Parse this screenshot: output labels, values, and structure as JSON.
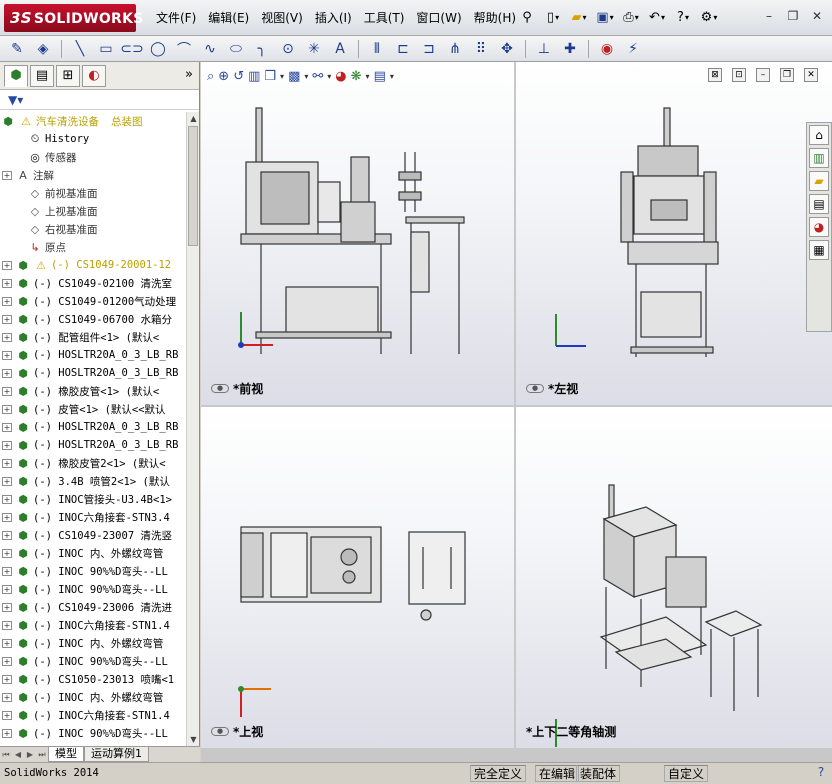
{
  "app": {
    "logo_prefix": "3S",
    "logo_text": "SOLIDWORKS"
  },
  "menu": [
    "文件(F)",
    "编辑(E)",
    "视图(V)",
    "插入(I)",
    "工具(T)",
    "窗口(W)",
    "帮助(H)"
  ],
  "title_icons": [
    "pin-icon",
    "new-document-icon",
    "open-folder-icon",
    "save-icon",
    "print-icon",
    "undo-icon",
    "help-icon",
    "options-icon"
  ],
  "window_controls": [
    "minimize-icon",
    "restore-icon",
    "close-icon"
  ],
  "command_icons": [
    "sketch-icon",
    "smart-dimension-icon",
    "line-icon",
    "rectangle-icon",
    "slot-icon",
    "circle-icon",
    "arc-icon",
    "spline-icon",
    "ellipse-icon",
    "fillet-icon",
    "point-icon",
    "centerline-icon",
    "text-icon",
    "mirror-icon",
    "offset-icon",
    "convert-icon",
    "trim-icon",
    "pattern-icon",
    "move-icon",
    "relation-icon",
    "repair-icon",
    "rapid-sketch-icon",
    "instant2d-icon"
  ],
  "panel_tabs": [
    "feature-manager-icon",
    "property-manager-icon",
    "configuration-manager-icon",
    "display-manager-icon"
  ],
  "panel_more": "»",
  "tree": {
    "root_name": "汽车清洗设备",
    "root_suffix": "总装图",
    "history": "History",
    "sensors": "传感器",
    "annotations": "注解",
    "plane_front": "前视基准面",
    "plane_top": "上视基准面",
    "plane_right": "右视基准面",
    "origin": "原点",
    "first_component": "(-) CS1049-20001-12",
    "components": [
      "(-) CS1049-02100 清洗室",
      "(-) CS1049-01200气动处理",
      "(-) CS1049-06700 水箱分",
      "(-) 配管组件<1> (默认<",
      "(-) HOSLTR20A_0_3_LB_RB",
      "(-) HOSLTR20A_0_3_LB_RB",
      "(-) 橡胶皮管<1> (默认<",
      "(-) 皮管<1> (默认<<默认",
      "(-) HOSLTR20A_0_3_LB_RB",
      "(-) HOSLTR20A_0_3_LB_RB",
      "(-) 橡胶皮管2<1> (默认<",
      "(-) 3.4B 喷管2<1> (默认",
      "(-) INOC管接头-U3.4B<1>",
      "(-) INOC六角接套-STN3.4",
      "(-) CS1049-23007 清洗竖",
      "(-) INOC 内、外螺纹弯管",
      "(-) INOC 90%%D弯头--LL",
      "(-) INOC 90%%D弯头--LL",
      "(-) CS1049-23006 清洗进",
      "(-) INOC六角接套-STN1.4",
      "(-) INOC 内、外螺纹弯管",
      "(-) INOC 90%%D弯头--LL",
      "(-) CS1050-23013 喷嘴<1",
      "(-) INOC 内、外螺纹弯管",
      "(-) INOC六角接套-STN1.4",
      "(-) INOC 90%%D弯头--LL"
    ]
  },
  "bottom_tabs": [
    "模型",
    "运动算例1"
  ],
  "view_toolbar_icons": [
    "zoom-to-fit-icon",
    "zoom-area-icon",
    "previous-view-icon",
    "section-view-icon",
    "view-orientation-icon",
    "display-style-icon",
    "hide-show-icon",
    "edit-appearance-icon",
    "apply-scene-icon",
    "view-settings-icon"
  ],
  "views": {
    "front": "*前视",
    "left": "*左视",
    "top": "*上视",
    "iso": "*上下二等角轴测"
  },
  "task_pane_icons": [
    "home-icon",
    "design-library-icon",
    "file-explorer-icon",
    "view-palette-icon",
    "appearances-icon",
    "custom-properties-icon"
  ],
  "status": {
    "version": "SolidWorks 2014",
    "defined": "完全定义",
    "editing": "在编辑",
    "assembly": "装配体",
    "custom": "自定义",
    "help": "?"
  }
}
